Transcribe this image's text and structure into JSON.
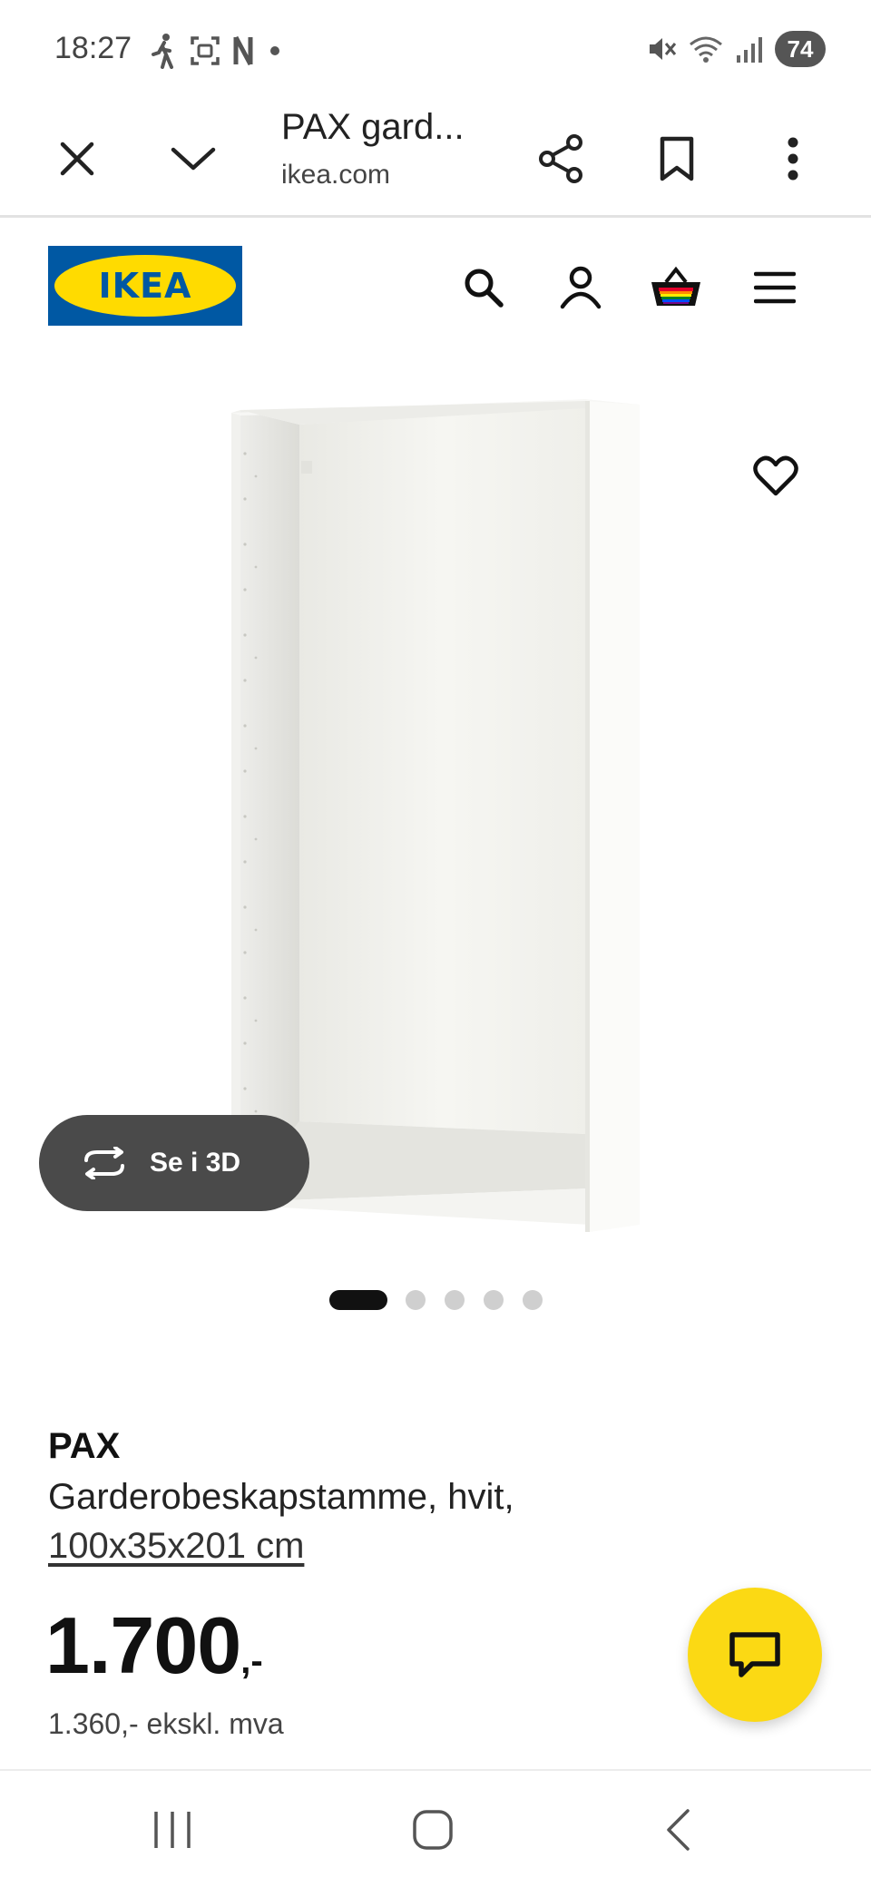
{
  "status_bar": {
    "time": "18:27",
    "battery": "74",
    "left_icons": [
      "walk-icon",
      "screenshot-icon",
      "netflix-icon",
      "dot-icon"
    ],
    "right_icons": [
      "mute-icon",
      "wifi-icon",
      "signal-icon"
    ]
  },
  "browser": {
    "tab_title": "PAX gard...",
    "url": "ikea.com",
    "icons": [
      "close-icon",
      "chevron-down-icon",
      "share-icon",
      "bookmark-icon",
      "more-vert-icon"
    ]
  },
  "header": {
    "logo_text": "IKEA",
    "logo_colors": {
      "blue": "#0058a3",
      "yellow": "#ffdb00"
    },
    "icons": [
      "search-icon",
      "account-icon",
      "basket-icon",
      "menu-icon"
    ]
  },
  "gallery": {
    "view_3d_label": "Se i 3D",
    "dot_count": 5,
    "active_index": 0
  },
  "product": {
    "name": "PAX",
    "description": "Garderobeskapstamme, hvit,",
    "size": "100x35x201 cm",
    "price_main": "1.700",
    "price_suffix": ",-",
    "price_ex_vat": "1.360,- ekskl. mva"
  },
  "chat": {
    "icon": "chat-icon",
    "color": "#fbd914"
  },
  "nav_bar": {
    "icons": [
      "recent-apps-icon",
      "home-icon",
      "back-icon"
    ]
  }
}
